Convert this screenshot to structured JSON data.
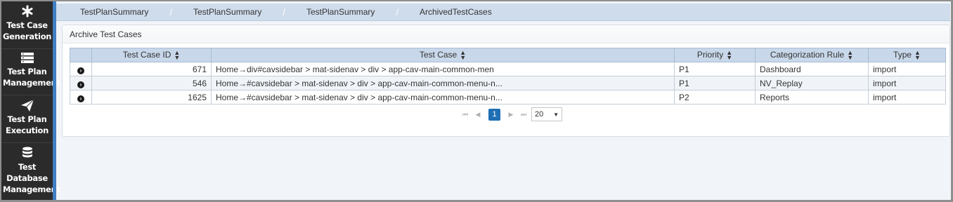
{
  "sidebar": {
    "items": [
      {
        "icon": "asterisk-icon",
        "label_line1": "Test Case",
        "label_line2": "Generation"
      },
      {
        "icon": "server-list-icon",
        "label_line1": "Test Plan",
        "label_line2": "Management"
      },
      {
        "icon": "paper-plane-icon",
        "label_line1": "Test Plan",
        "label_line2": "Execution"
      },
      {
        "icon": "database-icon",
        "label_line1": "Test Database",
        "label_line2": "Management"
      }
    ]
  },
  "breadcrumb": {
    "items": [
      "TestPlanSummary",
      "TestPlanSummary",
      "TestPlanSummary",
      "ArchivedTestCases"
    ],
    "separator": "/"
  },
  "panel": {
    "title": "Archive Test Cases"
  },
  "table": {
    "columns": [
      "Test Case ID",
      "Test Case",
      "Priority",
      "Categorization Rule",
      "Type"
    ],
    "rows": [
      {
        "id": "671",
        "test_case": "Home→div#cavsidebar > mat-sidenav > div > app-cav-main-common-men",
        "priority": "P1",
        "rule": "Dashboard",
        "type": "import"
      },
      {
        "id": "546",
        "test_case": "Home→#cavsidebar > mat-sidenav > div > app-cav-main-common-menu-n...",
        "priority": "P1",
        "rule": "NV_Replay",
        "type": "import"
      },
      {
        "id": "1625",
        "test_case": "Home→#cavsidebar > mat-sidenav > div > app-cav-main-common-menu-n...",
        "priority": "P2",
        "rule": "Reports",
        "type": "import"
      }
    ]
  },
  "paginator": {
    "current_page": "1",
    "page_size": "20"
  },
  "colors": {
    "sidebar_bg": "#2b2b2b",
    "accent": "#1f6fb5",
    "header_bg": "#c8d8ea",
    "breadcrumb_bg": "#cfdcec"
  }
}
